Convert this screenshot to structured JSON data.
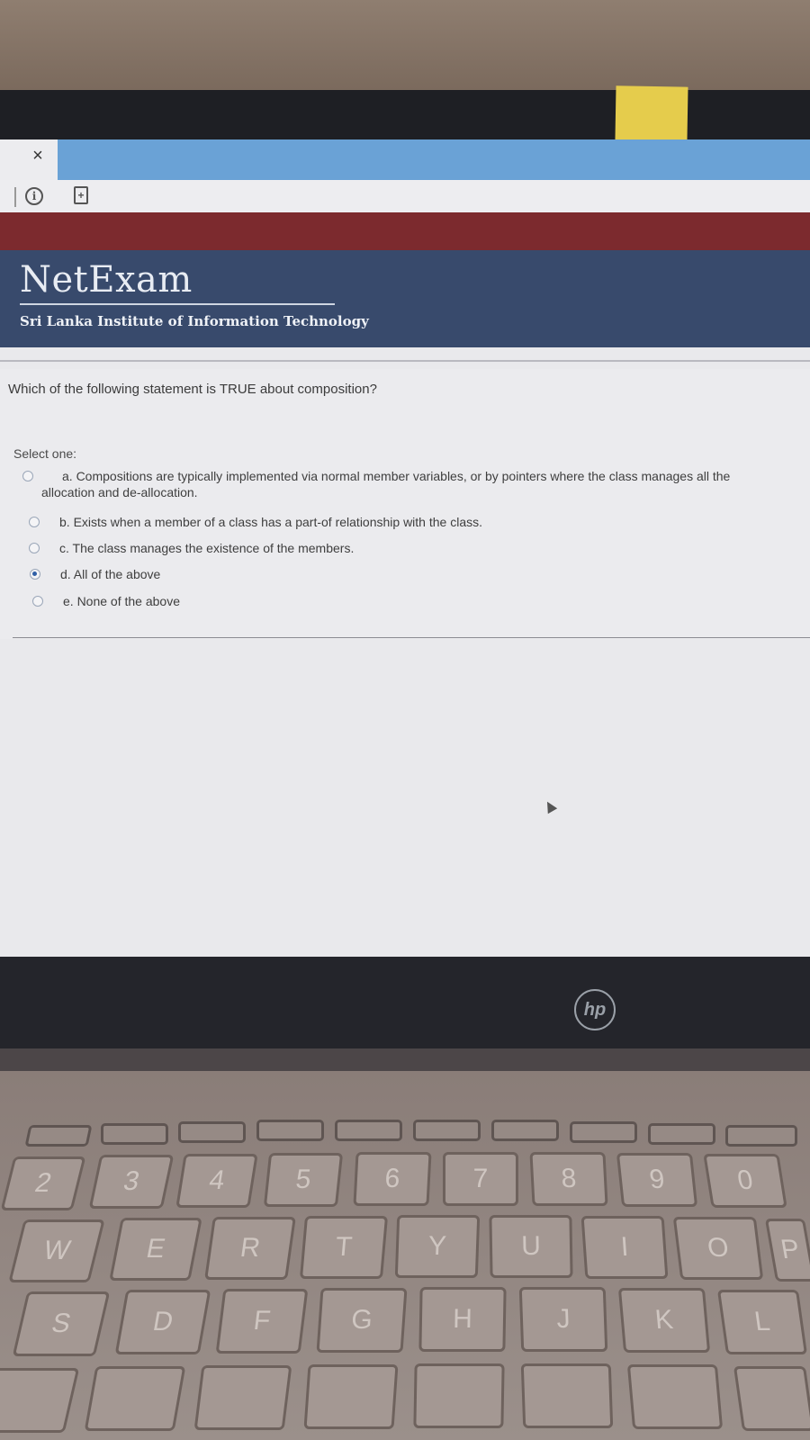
{
  "browser": {
    "close_glyph": "×",
    "info_glyph": "i",
    "page_glyph": "+"
  },
  "site": {
    "logo": "NetExam",
    "institute": "Sri Lanka Institute of Information Technology"
  },
  "quiz": {
    "question": "Which of the following statement is TRUE about composition?",
    "select_one": "Select one:",
    "options": [
      {
        "label": "a. Compositions are typically implemented via normal member variables, or by pointers where the class manages all the",
        "label_line2": "allocation and de-allocation.",
        "selected": false
      },
      {
        "label": "b. Exists when a member of a class has a part-of relationship with the class.",
        "selected": false
      },
      {
        "label": "c. The class manages the existence of the members.",
        "selected": false
      },
      {
        "label": "d. All of the above",
        "selected": true
      },
      {
        "label": "e. None of the above",
        "selected": false
      }
    ]
  },
  "laptop": {
    "brand": "hp"
  },
  "keyboard": {
    "row1": [
      "2",
      "3",
      "4",
      "5",
      "6",
      "7",
      "8",
      "9",
      "0"
    ],
    "row2": [
      "W",
      "E",
      "R",
      "T",
      "Y",
      "U",
      "I",
      "O",
      "P"
    ],
    "row3": [
      "S",
      "D",
      "F",
      "G",
      "H",
      "J",
      "K",
      "L"
    ]
  },
  "colors": {
    "header_blue": "#384a6c",
    "header_red": "#7c2a2e",
    "tab_blue": "#6aa2d6",
    "radio_checked": "#2f5fa6"
  }
}
